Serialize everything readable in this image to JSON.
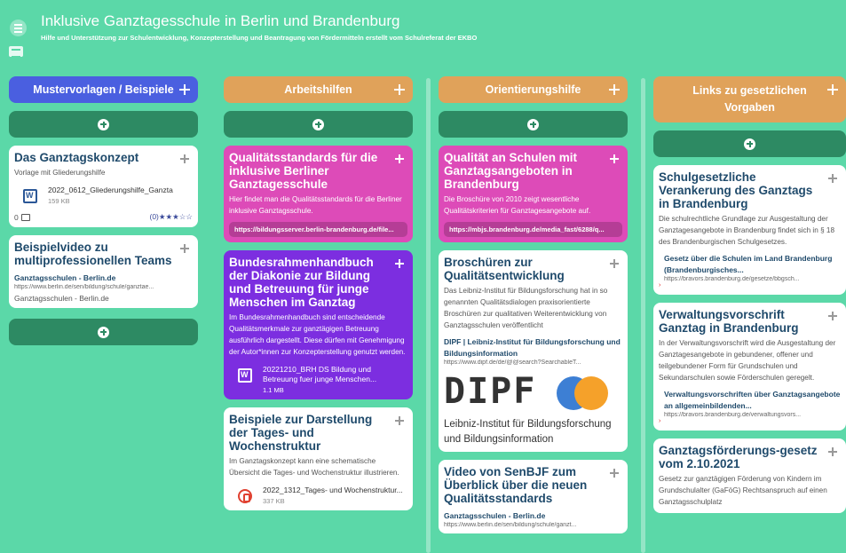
{
  "header": {
    "title": "Inklusive Ganztagesschule in Berlin und Brandenburg",
    "subtitle": "Hilfe und Unterstützung zur Schulentwicklung, Konzepterstellung und Beantragung von Fördermitteln erstellt vom Schulreferat der EKBO"
  },
  "colors": {
    "background": "#5bd8a8",
    "header_blue": "#4a5fe0",
    "header_orange": "#e0a25a",
    "add_button": "#2d8a63",
    "card_pink": "#dd4bb8",
    "card_purple": "#7c2ee0"
  },
  "columns": [
    {
      "header": "Mustervorlagen / Beispiele",
      "cards": [
        {
          "title": "Das Ganztagskonzept",
          "desc": "Vorlage mit Gliederungshilfe",
          "file_name": "2022_0612_Gliederungshilfe_Ganzta",
          "file_size": "159 KB",
          "comments": "0",
          "rating": "(0)★★★☆☆"
        },
        {
          "title": "Beispielvideo zu multiprofessionellen Teams",
          "link_title": "Ganztagsschulen - Berlin.de",
          "link_url": "https://www.berlin.de/sen/bildung/schule/ganztae...",
          "img_alt": "Ganztagsschulen - Berlin.de"
        }
      ]
    },
    {
      "header": "Arbeitshilfen",
      "cards": [
        {
          "title": "Qualitätsstandards für die inklusive Berliner Ganztagesschule",
          "desc": "Hier findet man die Qualitätsstandards für die Berliner inklusive Ganztagsschule.",
          "url": "https://bildungsserver.berlin-brandenburg.de/file..."
        },
        {
          "title": "Bundesrahmenhandbuch der Diakonie zur Bildung und Betreuung für junge Menschen im Ganztag",
          "desc": "Im Bundesrahmenhandbuch sind entscheidende Qualitätsmerkmale zur ganztägigen Betreuung ausführlich dargestellt. Diese dürfen mit Genehmigung der Autor*innen zur Konzepterstellung genutzt werden.",
          "file_name": "20221210_BRH DS Bildung und Betreuung fuer junge Menschen...",
          "file_size": "1.1 MB"
        },
        {
          "title": "Beispiele zur Darstellung der Tages- und Wochenstruktur",
          "desc": "Im Ganztagskonzept kann eine schematische Übersicht die Tages- und Wochenstruktur illustrieren.",
          "file_name": "2022_1312_Tages- und Wochenstruktur...",
          "file_size": "337 KB"
        }
      ]
    },
    {
      "header": "Orientierungshilfe",
      "cards": [
        {
          "title": "Qualität an Schulen mit Ganztagsangeboten in Brandenburg",
          "desc": "Die Broschüre von 2010 zeigt wesentliche Qualitätskriterien für Ganztagesangebote auf.",
          "url": "https://mbjs.brandenburg.de/media_fast/6288/q..."
        },
        {
          "title": "Broschüren zur Qualitätsentwicklung",
          "desc": "Das Leibniz-Institut für Bildungsforschung hat in so genannten Qualitätsdialogen praxisorientierte Broschüren zur qualitativen Weiterentwicklung von Ganztagsschulen veröffentlicht",
          "link_title": "DIPF | Leibniz-Institut für Bildungsforschung und Bildungsinformation",
          "link_url": "https://www.dipf.de/de/@@search?SearchableT...",
          "logo_text": "DIPF",
          "logo_sub": "Leibniz-Institut für Bildungsforschung und Bildungsinformation"
        },
        {
          "title": "Video von SenBJF zum Überblick über die neuen Qualitätsstandards",
          "link_title": "Ganztagsschulen - Berlin.de",
          "link_url": "https://www.berlin.de/sen/bildung/schule/ganzt..."
        }
      ]
    },
    {
      "header": "Links zu gesetzlichen Vorgaben",
      "cards": [
        {
          "title": "Schulgesetzliche Verankerung des Ganztags in Brandenburg",
          "desc": "Die schulrechtliche Grundlage zur Ausgestaltung der Ganztagesangebote in Brandenburg findet sich in § 18 des Brandenburgischen Schulgesetzes.",
          "link_title": "Gesetz über die Schulen im Land Brandenburg (Brandenburgisches...",
          "link_url": "https://bravors.brandenburg.de/gesetze/bbgsch..."
        },
        {
          "title": "Verwaltungsvorschrift Ganztag in Brandenburg",
          "desc": "In der Verwaltungsvorschrift wird die Ausgestaltung der Ganztagesangebote in gebundener, offener und teilgebundener Form für Grundschulen und Sekundarschulen sowie Förderschulen geregelt.",
          "link_title": "Verwaltungsvorschriften über Ganztagsangebote an allgemeinbildenden...",
          "link_url": "https://bravors.brandenburg.de/verwaltungsvors..."
        },
        {
          "title": "Ganztagsförderungs-gesetz vom 2.10.2021",
          "desc": "Gesetz zur ganztägigen Förderung von Kindern im Grundschulalter (GaFöG) Rechtsanspruch auf einen Ganztagsschulplatz"
        }
      ]
    }
  ]
}
